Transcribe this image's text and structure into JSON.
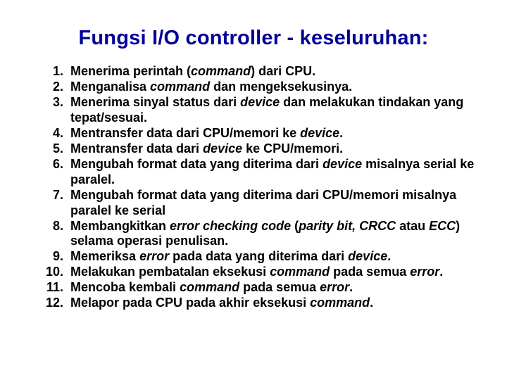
{
  "title": "Fungsi I/O controller - keseluruhan:",
  "items": [
    {
      "html": "Menerima perintah (<em class='ital'>command</em>) dari CPU."
    },
    {
      "html": "Menganalisa <em class='ital'>command</em> dan mengeksekusinya."
    },
    {
      "html": "Menerima sinyal status dari <em class='ital'>device</em> dan melakukan tindakan yang tepat/sesuai."
    },
    {
      "html": "Mentransfer data dari CPU/memori ke <em class='ital'>device</em>."
    },
    {
      "html": "Mentransfer data dari <em class='ital'>device</em> ke CPU/memori."
    },
    {
      "html": "Mengubah format data yang diterima dari <em class='ital'>device</em> misalnya serial ke paralel."
    },
    {
      "html": "Mengubah format data yang diterima dari CPU/memori misalnya paralel ke serial"
    },
    {
      "html": "Membangkitkan <em class='ital'>error checking code</em> (<em class='ital'>parity bit, CRCC</em> atau <em class='ital'>ECC</em>) selama operasi penulisan."
    },
    {
      "html": "Memeriksa <em class='ital'>error</em> pada data yang diterima dari <em class='ital'>device</em>."
    },
    {
      "html": "Melakukan pembatalan eksekusi <em class='ital'>command</em> pada semua <em class='ital'>error</em>."
    },
    {
      "html": "Mencoba kembali <em class='ital'>command</em> pada semua <em class='ital'>error</em>."
    },
    {
      "html": "Melapor pada CPU pada akhir eksekusi <em class='ital'>command</em>."
    }
  ]
}
